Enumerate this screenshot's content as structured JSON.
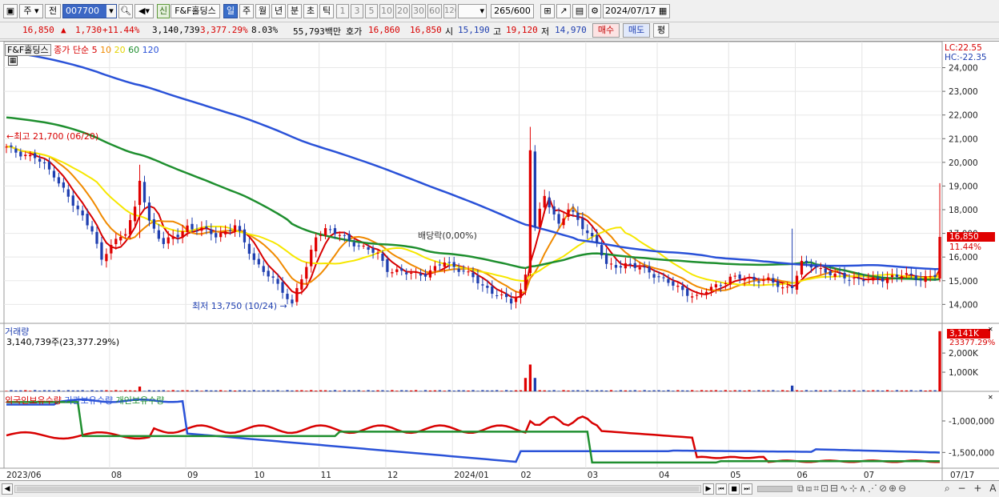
{
  "toolbar": {
    "market": "주",
    "prev": "전",
    "code": "007700",
    "new_tag": "신",
    "stock_name": "F&F홀딩스",
    "periods": [
      "일",
      "주",
      "월",
      "년",
      "분",
      "초",
      "틱"
    ],
    "minutes": [
      "1",
      "3",
      "5",
      "10",
      "20",
      "30",
      "60",
      "120"
    ],
    "count": "265",
    "count_total": "/600",
    "date": "2024/07/17"
  },
  "quote": {
    "price": "16,850",
    "change_arrow": "▲",
    "change": "1,730",
    "change_pct": "+11.44%",
    "volume": "3,140,739",
    "volume_pct": "3,377.29%",
    "turnover_pct": "8.03%",
    "amount": "55,793백만",
    "bid_label": "호가",
    "ask": "16,860",
    "bid": "16,850",
    "open_label": "시",
    "open": "15,190",
    "high_label": "고",
    "high": "19,120",
    "low_label": "저",
    "low": "14,970",
    "buy_button": "매수",
    "sell_button": "매도",
    "eval_button": "평"
  },
  "legend": {
    "name": "F&F홀딩스",
    "ma_label": "종가 단순",
    "ma_periods": [
      "5",
      "10",
      "20",
      "60",
      "120"
    ],
    "ma_colors": [
      "#d80000",
      "#f08a00",
      "#f6e700",
      "#1f8f2f",
      "#2a52d8"
    ],
    "volume_title": "거래량",
    "volume_value": "3,140,739주(23,377.29%)",
    "holders": [
      "외국인보유수량",
      "기관보유수량",
      "개인보유수량"
    ],
    "holder_colors": [
      "#d80000",
      "#2a52d8",
      "#1f8f2f"
    ]
  },
  "annotations": {
    "high": "최고 21,700 (06/20)",
    "low": "최저 13,750 (10/24)",
    "dividend": "배당락(0,00%)"
  },
  "right_panel": {
    "lc": "LC:22.55",
    "hc": "HC:-22.35",
    "price_box": "16,850",
    "price_pct": "11.44%",
    "vol_box": "3,141K",
    "vol_pct": "23377.29%"
  },
  "chart_data": [
    {
      "type": "candlestick",
      "title": "F&F홀딩스 일봉",
      "y_ticks": [
        14000,
        15000,
        16000,
        17000,
        18000,
        19000,
        20000,
        21000,
        22000,
        23000,
        24000
      ],
      "y_tick_labels": [
        "14,000",
        "15,000",
        "16,000",
        "17,000",
        "18,000",
        "19,000",
        "20,000",
        "21,000",
        "22,000",
        "23,000",
        "24,000"
      ],
      "ylim": [
        13200,
        25100
      ],
      "x_labels": [
        "2023/06",
        "08",
        "09",
        "10",
        "11",
        "12",
        "2024/01",
        "02",
        "03",
        "04",
        "05",
        "06",
        "07",
        "07/17"
      ],
      "x_label_pos": [
        0,
        22,
        38,
        52,
        66,
        80,
        94,
        108,
        122,
        137,
        152,
        166,
        180,
        196
      ],
      "n_days": 197,
      "price_keys": [
        [
          0,
          20600
        ],
        [
          2,
          20450
        ],
        [
          6,
          20200
        ],
        [
          10,
          19500
        ],
        [
          14,
          18200
        ],
        [
          18,
          17200
        ],
        [
          20,
          15800
        ],
        [
          22,
          16500
        ],
        [
          25,
          17100
        ],
        [
          27,
          18000
        ],
        [
          28,
          19200
        ],
        [
          30,
          17500
        ],
        [
          33,
          16600
        ],
        [
          36,
          16900
        ],
        [
          38,
          17300
        ],
        [
          42,
          17100
        ],
        [
          44,
          16900
        ],
        [
          48,
          17300
        ],
        [
          50,
          16600
        ],
        [
          52,
          15900
        ],
        [
          55,
          15200
        ],
        [
          58,
          14600
        ],
        [
          60,
          14000
        ],
        [
          61,
          14700
        ],
        [
          63,
          15500
        ],
        [
          65,
          16900
        ],
        [
          67,
          17200
        ],
        [
          70,
          16900
        ],
        [
          74,
          16500
        ],
        [
          78,
          16100
        ],
        [
          80,
          15500
        ],
        [
          84,
          15300
        ],
        [
          88,
          15300
        ],
        [
          90,
          15500
        ],
        [
          92,
          15800
        ],
        [
          94,
          15600
        ],
        [
          96,
          15400
        ],
        [
          100,
          14800
        ],
        [
          104,
          14300
        ],
        [
          106,
          14100
        ],
        [
          108,
          14600
        ],
        [
          109,
          15300
        ],
        [
          110,
          20600
        ],
        [
          111,
          17200
        ],
        [
          113,
          18600
        ],
        [
          116,
          17400
        ],
        [
          118,
          18000
        ],
        [
          121,
          17300
        ],
        [
          124,
          16600
        ],
        [
          126,
          15600
        ],
        [
          130,
          15700
        ],
        [
          135,
          15400
        ],
        [
          140,
          14800
        ],
        [
          145,
          14300
        ],
        [
          148,
          14700
        ],
        [
          152,
          15100
        ],
        [
          156,
          15100
        ],
        [
          160,
          15000
        ],
        [
          163,
          14700
        ],
        [
          165,
          14800
        ],
        [
          167,
          15700
        ],
        [
          170,
          15600
        ],
        [
          174,
          15200
        ],
        [
          178,
          15100
        ],
        [
          182,
          15000
        ],
        [
          186,
          15200
        ],
        [
          190,
          15200
        ],
        [
          192,
          15100
        ],
        [
          195,
          15200
        ],
        [
          196,
          16850
        ]
      ],
      "spikes": [
        [
          28,
          19900,
          16800
        ],
        [
          110,
          21500,
          15600
        ],
        [
          165,
          17200,
          14700
        ],
        [
          196,
          19120,
          14970
        ]
      ],
      "volume": {
        "ylim": [
          0,
          3300000
        ],
        "y_ticks": [
          1000000,
          2000000
        ],
        "y_tick_labels": [
          "1,000K",
          "2,000K"
        ],
        "last": 3141000
      },
      "holders": {
        "y_ticks": [
          -1000000,
          -1500000
        ],
        "y_tick_labels": [
          "-1,000,000",
          "-1,500,000"
        ],
        "ylim": [
          -1750000,
          -530000
        ]
      }
    }
  ],
  "bottom": {
    "nav_buttons": [
      "▶",
      "⏮",
      "■",
      "⏭"
    ]
  }
}
